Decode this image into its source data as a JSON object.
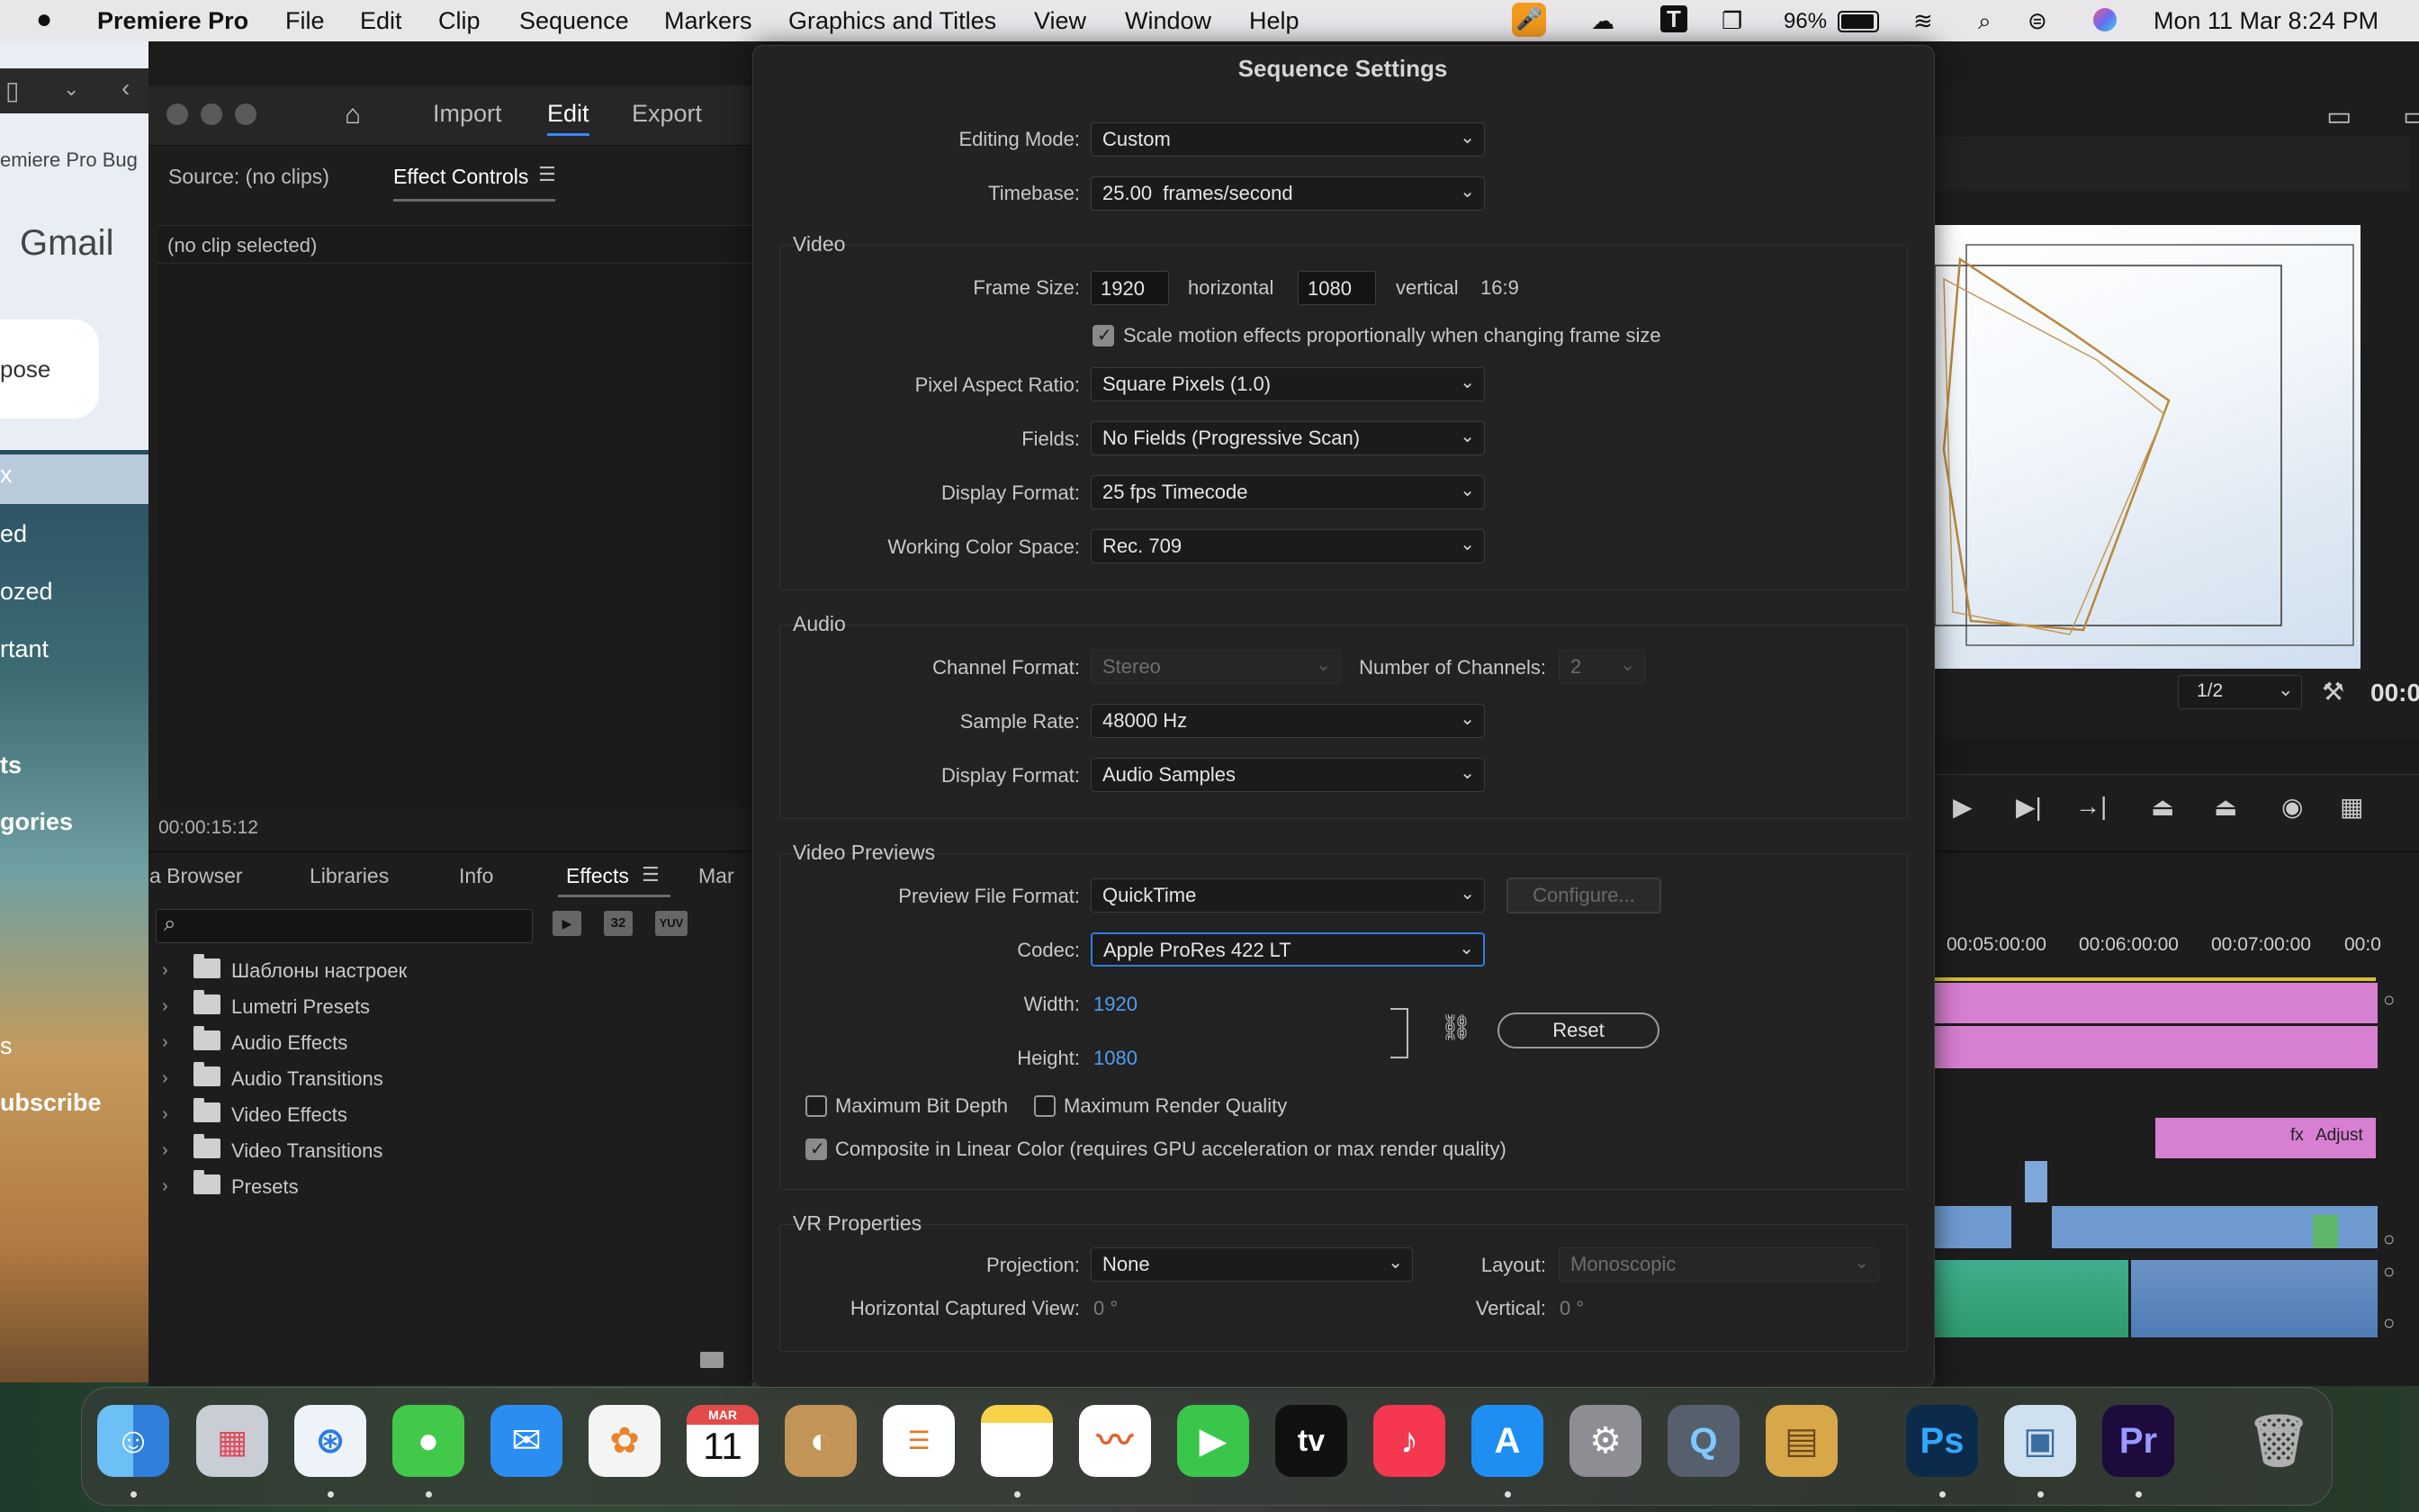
{
  "menubar": {
    "apple": "",
    "app_name": "Premiere Pro",
    "items": [
      "File",
      "Edit",
      "Clip",
      "Sequence",
      "Markers",
      "Graphics and Titles",
      "View",
      "Window",
      "Help"
    ],
    "battery": "96%",
    "datetime": "Mon 11 Mar  8:24 PM"
  },
  "gmail": {
    "title": "Gmail",
    "compose": "pose",
    "items": [
      "x",
      "ed",
      "ozed",
      "rtant",
      "ts",
      "gories",
      "s",
      "ubscribe"
    ],
    "tab_label": "emiere Pro Bug"
  },
  "premiere": {
    "workspace_tabs": [
      "Import",
      "Edit",
      "Export"
    ],
    "active_workspace": "Edit",
    "source_tab": "Source: (no clips)",
    "effect_controls_tab": "Effect Controls",
    "no_clip": "(no clip selected)",
    "timecode": "00:00:15:12",
    "bottom_tabs": [
      "a Browser",
      "Libraries",
      "Info",
      "Effects",
      "Mar"
    ],
    "effects_list": [
      "Шаблоны настроек",
      "Lumetri Presets",
      "Audio Effects",
      "Audio Transitions",
      "Video Effects",
      "Video Transitions",
      "Presets"
    ],
    "fx_icons": [
      "32",
      "YUV"
    ],
    "program": {
      "zoom": "1/2",
      "timecode": "00:0",
      "ruler": [
        "00:05:00:00",
        "00:06:00:00",
        "00:07:00:00",
        "00:0"
      ],
      "clip_label": "Adjust"
    }
  },
  "dialog": {
    "title": "Sequence Settings",
    "editing_mode_label": "Editing Mode:",
    "editing_mode": "Custom",
    "timebase_label": "Timebase:",
    "timebase": "25.00  frames/second",
    "video": {
      "title": "Video",
      "frame_size_label": "Frame Size:",
      "width": "1920",
      "horizontal": "horizontal",
      "height": "1080",
      "vertical": "vertical",
      "aspect": "16:9",
      "scale_label": "Scale motion effects proportionally when changing frame size",
      "scale_checked": true,
      "par_label": "Pixel Aspect Ratio:",
      "par": "Square Pixels (1.0)",
      "fields_label": "Fields:",
      "fields": "No Fields (Progressive Scan)",
      "display_format_label": "Display Format:",
      "display_format": "25 fps Timecode",
      "color_space_label": "Working Color Space:",
      "color_space": "Rec. 709"
    },
    "audio": {
      "title": "Audio",
      "channel_format_label": "Channel Format:",
      "channel_format": "Stereo",
      "channels_label": "Number of Channels:",
      "channels": "2",
      "sample_rate_label": "Sample Rate:",
      "sample_rate": "48000 Hz",
      "display_format_label": "Display Format:",
      "display_format": "Audio Samples"
    },
    "previews": {
      "title": "Video Previews",
      "file_format_label": "Preview File Format:",
      "file_format": "QuickTime",
      "configure": "Configure...",
      "codec_label": "Codec:",
      "codec": "Apple ProRes 422 LT",
      "width_label": "Width:",
      "width": "1920",
      "height_label": "Height:",
      "height": "1080",
      "reset": "Reset",
      "max_bit_depth": "Maximum Bit Depth",
      "max_render_quality": "Maximum Render Quality",
      "composite_linear": "Composite in Linear Color (requires GPU acceleration or max render quality)"
    },
    "vr": {
      "title": "VR Properties",
      "projection_label": "Projection:",
      "projection": "None",
      "layout_label": "Layout:",
      "layout": "Monoscopic",
      "hcv_label": "Horizontal Captured View:",
      "hcv": "0 °",
      "vertical_label": "Vertical:",
      "vertical": "0 °"
    }
  },
  "dock": {
    "calendar_month": "MAR",
    "calendar_day": "11",
    "apps": [
      "Finder",
      "Launchpad",
      "Safari",
      "Messages",
      "Mail",
      "Photos",
      "Calendar",
      "Contacts",
      "Reminders",
      "Notes",
      "Freeform",
      "FaceTime",
      "TV",
      "Music",
      "App Store",
      "System Settings",
      "QuickTime",
      "Archive Utility",
      "Photoshop",
      "Preview",
      "Premiere Pro",
      "Trash"
    ],
    "tv_label": "tv",
    "ps_label": "Ps",
    "pr_label": "Pr"
  }
}
